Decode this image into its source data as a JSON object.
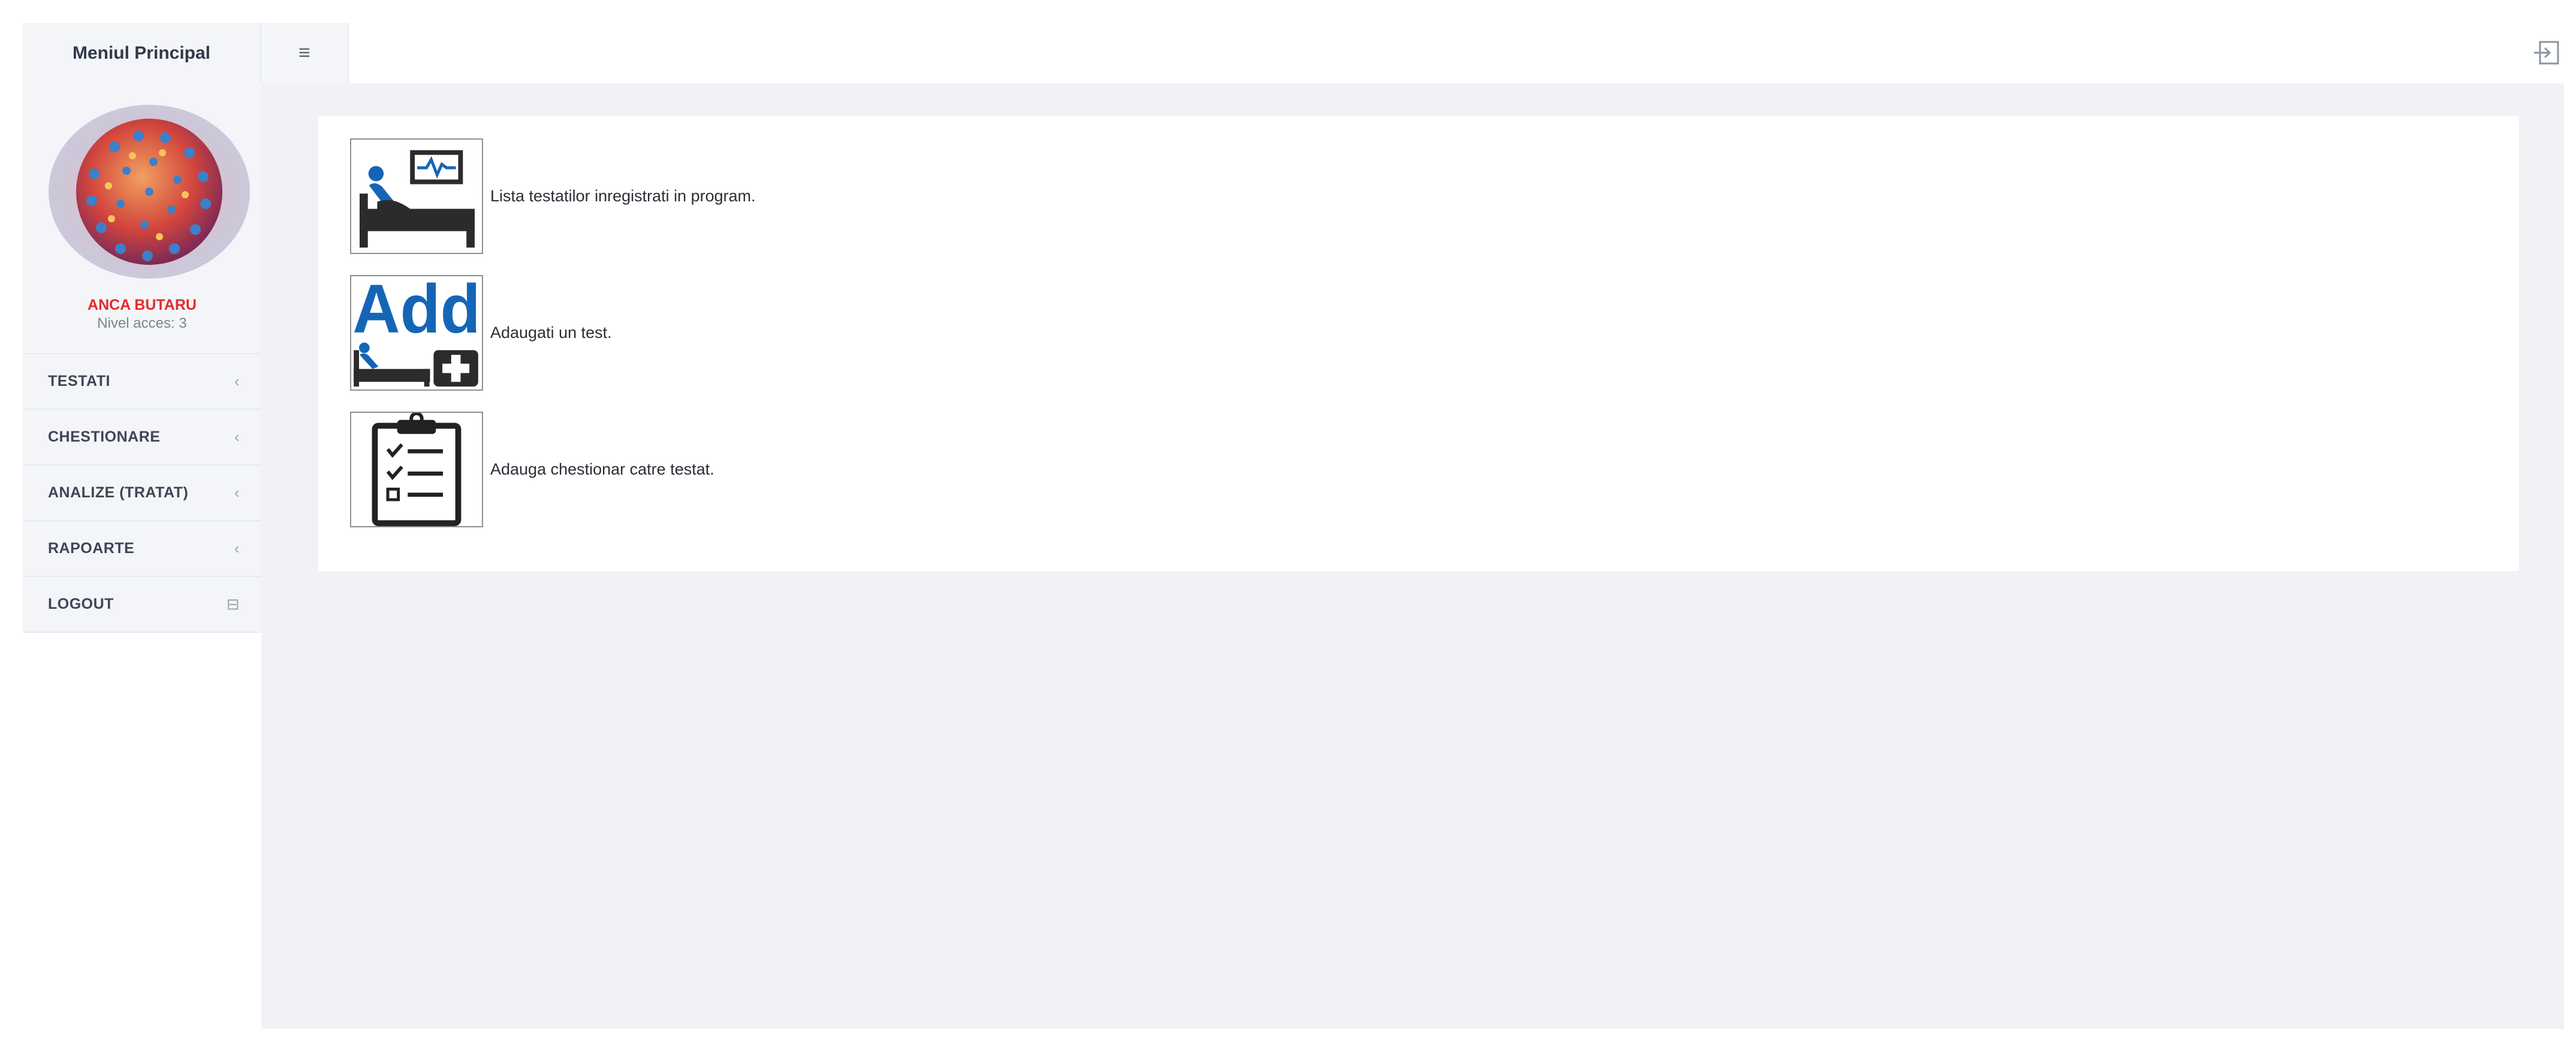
{
  "topbar": {
    "brand": "Meniul Principal",
    "toggle_icon": "hamburger-icon",
    "exit_icon": "sign-out-icon"
  },
  "profile": {
    "name": "ANCA BUTARU",
    "level": "Nivel acces: 3"
  },
  "menu": [
    {
      "label": "TESTATI",
      "icon": "chevron-left-icon",
      "glyph": "‹"
    },
    {
      "label": "CHESTIONARE",
      "icon": "chevron-left-icon",
      "glyph": "‹"
    },
    {
      "label": "ANALIZE (TRATAT)",
      "icon": "chevron-left-icon",
      "glyph": "‹"
    },
    {
      "label": "RAPOARTE",
      "icon": "chevron-left-icon",
      "glyph": "‹"
    },
    {
      "label": "LOGOUT",
      "icon": "logout-icon",
      "glyph": "⊟"
    }
  ],
  "entries": [
    {
      "icon": "patient-bed-monitor-icon",
      "text": "Lista testatilor inregistrati in program."
    },
    {
      "icon": "add-patient-icon",
      "icon_text": "Add",
      "text": "Adaugati un test."
    },
    {
      "icon": "clipboard-checklist-icon",
      "text": "Adauga chestionar catre testat."
    }
  ],
  "colors": {
    "accent_blue": "#1565b7",
    "username_red": "#e52a2a",
    "background": "#f1f2f6"
  }
}
